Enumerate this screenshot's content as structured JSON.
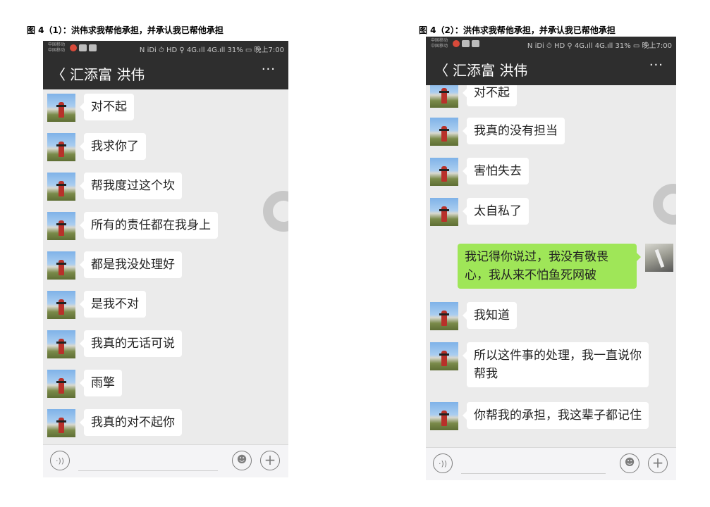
{
  "captions": {
    "left": "图 4（1）：洪伟求我帮他承担，并承认我已帮他承担",
    "right": "图 4（2）：洪伟求我帮他承担，并承认我已帮他承担"
  },
  "status_bar": {
    "carrier_line1": "中国移动",
    "carrier_line2": "中国移动",
    "right_text": "N iDi ⏱ HD ⚲ 4G.ıll 4G.ıll 31% ▭ 晚上7:00"
  },
  "chat": {
    "back_glyph": "〈",
    "title": "汇添富 洪伟",
    "more_glyph": "···"
  },
  "phone_left_messages": [
    "对不起",
    "我求你了",
    "帮我度过这个坎",
    "所有的责任都在我身上",
    "都是我没处理好",
    "是我不对",
    "我真的无话可说",
    "雨擎",
    "我真的对不起你"
  ],
  "phone_right_messages": [
    {
      "text": "对不起",
      "side": "left"
    },
    {
      "text": "我真的没有担当",
      "side": "left"
    },
    {
      "text": "害怕失去",
      "side": "left"
    },
    {
      "text": "太自私了",
      "side": "left"
    },
    {
      "text": "我记得你说过，我没有敬畏心，我从来不怕鱼死网破",
      "side": "right"
    },
    {
      "text": "我知道",
      "side": "left"
    },
    {
      "text": "所以这件事的处理，我一直说你帮我",
      "side": "left"
    },
    {
      "text": "你帮我的承担，我这辈子都记住",
      "side": "left"
    }
  ],
  "input_bar": {
    "voice_icon": "voice-icon",
    "voice_glyph": "·))",
    "emoji_icon": "emoji-icon",
    "emoji_glyph": "☻",
    "plus_icon": "plus-icon",
    "plus_glyph": "+"
  },
  "colors": {
    "navbar": "#2e2e2e",
    "chat_bg": "#ebebeb",
    "outgoing_bubble": "#9fe658",
    "incoming_bubble": "#ffffff"
  }
}
